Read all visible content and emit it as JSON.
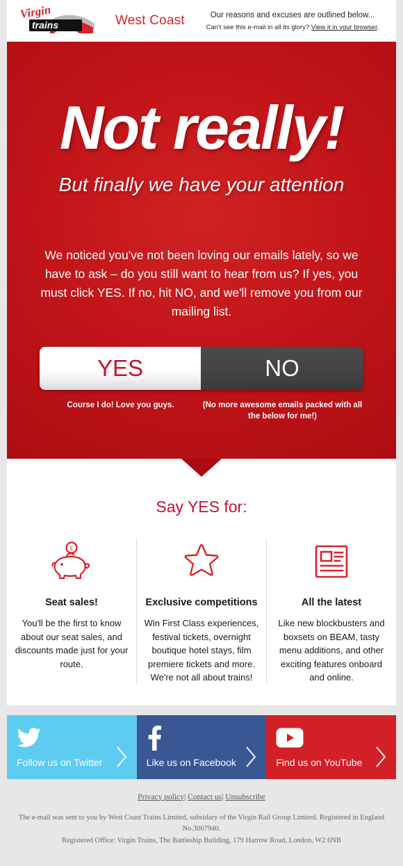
{
  "header": {
    "brand_script": "Virgin",
    "brand_word": "trains",
    "sub_brand": "West Coast",
    "tagline": "Our reasons and excuses are outlined below...",
    "browser_prefix": "Can't see this e-mail in all its glory? ",
    "browser_link": "View it in your browser",
    "browser_suffix": "."
  },
  "hero": {
    "title": "Not really!",
    "subtitle": "But finally we have your attention",
    "body": "We noticed you've not been loving our emails lately, so we have to ask – do you still want to hear from us? If yes, you must click YES. If no, hit NO, and we'll remove you from our mailing list.",
    "yes_label": "YES",
    "no_label": "NO",
    "yes_caption": "Course I do! Love you guys.",
    "no_caption": "(No more awesome emails packed with all the below for me!)"
  },
  "panel": {
    "title": "Say YES for:",
    "columns": [
      {
        "icon": "piggy-bank-icon",
        "heading": "Seat sales!",
        "text": "You'll be the first to know about our seat sales, and discounts made just for your route."
      },
      {
        "icon": "star-icon",
        "heading": "Exclusive competitions",
        "text": "Win First Class experiences, festival tickets, overnight boutique hotel stays, film premiere tickets and more. We're not all about trains!"
      },
      {
        "icon": "newspaper-icon",
        "heading": "All the latest",
        "text": "Like new blockbusters and boxsets on BEAM, tasty menu additions, and other exciting features onboard and online."
      }
    ]
  },
  "social": [
    {
      "icon": "twitter-icon",
      "label": "Follow us on Twitter",
      "color": "#5ecbf0"
    },
    {
      "icon": "facebook-icon",
      "label": "Like us on Facebook",
      "color": "#3a5795"
    },
    {
      "icon": "youtube-icon",
      "label": "Find us on YouTube",
      "color": "#d32027"
    }
  ],
  "footer": {
    "link_privacy": "Privacy policy",
    "sep1": "| ",
    "link_contact": "Contact us",
    "sep2": "| ",
    "link_unsubscribe": "Unsubscribe",
    "legal_line1": "The e-mail was sent to you by West Coast Trains Limited, subsidary of the Virgin Rail Group Limited. Registered in England No.3007940.",
    "legal_line2": "Registered Office: Virgin Trains, The Battleship Building, 179 Harrow Road, London, W2 6NB"
  },
  "colors": {
    "brand_red": "#c8102e",
    "hero_red": "#c01419",
    "page_bg": "#e7e7e7"
  }
}
